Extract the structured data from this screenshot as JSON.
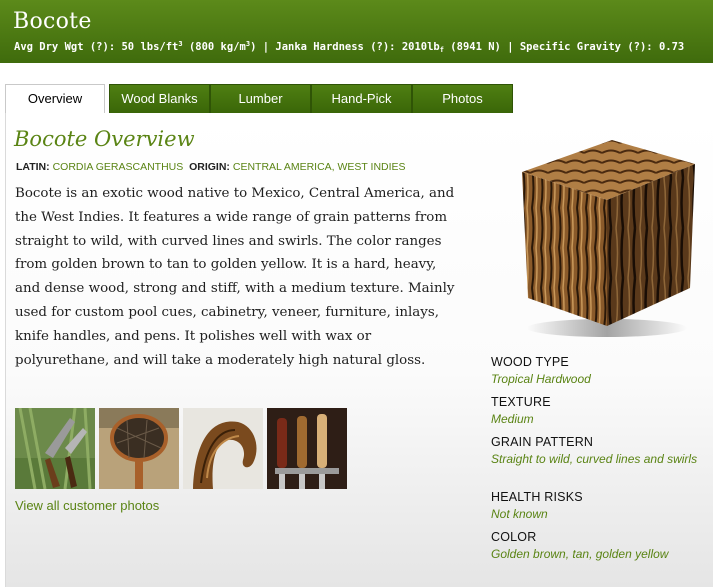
{
  "header": {
    "title": "Bocote",
    "avg_dry_wgt_label": "Avg Dry Wgt (?):",
    "avg_dry_wgt_value": "50 lbs/ft",
    "avg_dry_wgt_metric": "(800 kg/m",
    "janka_label": "Janka Hardness (?):",
    "janka_value": "2010lb",
    "janka_metric": "(8941 N)",
    "sg_label": "Specific Gravity (?):",
    "sg_value": "0.73",
    "separator": "|"
  },
  "tabs": [
    {
      "label": "Overview",
      "active": true
    },
    {
      "label": "Wood Blanks",
      "active": false
    },
    {
      "label": "Lumber",
      "active": false
    },
    {
      "label": "Hand-Pick",
      "active": false
    },
    {
      "label": "Photos",
      "active": false
    }
  ],
  "overview": {
    "title": "Bocote Overview",
    "latin_label": "LATIN:",
    "latin_value": "CORDIA GERASCANTHUS",
    "origin_label": "ORIGIN:",
    "origin_value": "CENTRAL AMERICA, WEST INDIES",
    "description": "Bocote is an exotic wood native to Mexico, Central America, and the West Indies. It features a wide range of grain patterns from straight to wild, with curved lines and swirls. The color ranges from golden brown to tan to golden yellow. It is a hard, heavy, and dense wood, strong and stiff, with a medium texture. Mainly used for custom pool cues, cabinetry, veneer, furniture, inlays, knife handles, and pens. It polishes well with wax or polyurethane, and will take a moderately high natural gloss.",
    "view_all_photos": "View all customer photos"
  },
  "properties": [
    {
      "label": "WOOD TYPE",
      "value": "Tropical Hardwood"
    },
    {
      "label": "TEXTURE",
      "value": "Medium"
    },
    {
      "label": "GRAIN PATTERN",
      "value": "Straight to wild, curved lines and swirls"
    },
    {
      "label": "HEALTH RISKS",
      "value": "Not known"
    },
    {
      "label": "COLOR",
      "value": "Golden brown, tan, golden yellow"
    }
  ],
  "colors": {
    "brand_green": "#4a7a10",
    "accent_text": "#5a8414"
  }
}
